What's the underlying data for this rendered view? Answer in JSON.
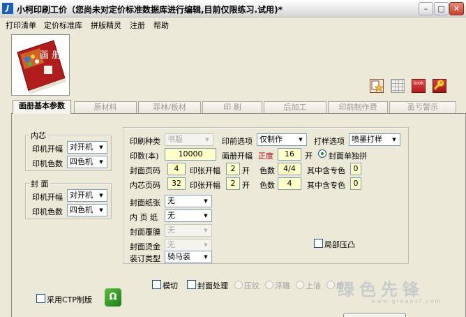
{
  "window": {
    "title": "小柯印刷工价（您尚未对定价标准数据库进行编辑,目前仅限练习.试用)*",
    "app_icon_text": "J",
    "minimize": "–",
    "maximize": "□",
    "close": "✕"
  },
  "menu": [
    "打印清单",
    "定价标准库",
    "拼版精灵",
    "注册",
    "帮助"
  ],
  "product_image": {
    "text": "画 册"
  },
  "toolbar_icons": [
    "star-icon",
    "grid-icon",
    "book-icon",
    "key-icon"
  ],
  "book_icon_text": "book",
  "key_icon_text": "🔑",
  "tabs": [
    "画册基本参数",
    "原材料",
    "菲林/板材",
    "印 刷",
    "后加工",
    "印前制作费",
    "盈亏警示"
  ],
  "inner": {
    "legend": "内芯",
    "size_label": "印机开幅",
    "size_value": "对开机",
    "color_label": "印机色数",
    "color_value": "四色机"
  },
  "cover": {
    "legend": "封 面",
    "size_label": "印机开幅",
    "size_value": "对开机",
    "color_label": "印机色数",
    "color_value": "四色机"
  },
  "form": {
    "print_type_label": "印刷种类",
    "print_type_value": "书版",
    "prepress_label": "印前选项",
    "prepress_value": "仅制作",
    "proof_label": "打样选项",
    "proof_value": "喷墨打样",
    "qty_label": "印数(本)",
    "qty_value": "10000",
    "album_size_label": "画册开幅",
    "album_size_dir": "正度",
    "album_size_value": "16",
    "kai": "开",
    "cover_single_label": "封面单独拼",
    "cover_pages_label": "封面页码",
    "cover_pages_value": "4",
    "sheet_size_label": "印张开幅",
    "cover_sheet_value": "2",
    "colors_label": "色数",
    "cover_colors_value": "4/4",
    "spot_label": "其中含专色",
    "cover_spot_value": "0",
    "inner_pages_label": "内芯页码",
    "inner_pages_value": "32",
    "inner_sheet_value": "2",
    "inner_colors_value": "4",
    "inner_spot_value": "0",
    "cover_paper_label": "封面纸张",
    "cover_paper_value": "无",
    "inner_paper_label": "内 页 纸",
    "inner_paper_value": "无",
    "lamination_label": "封面覆膜",
    "lamination_value": "无",
    "foil_label": "封面烫金",
    "foil_value": "无",
    "binding_label": "装订类型",
    "binding_value": "骑马装",
    "partial_emboss_label": "局部压凸",
    "die_cut_label": "模切",
    "cover_process_label": "封面处理",
    "cover_process_options": [
      "压纹",
      "浮雕",
      "上油",
      "磨光"
    ],
    "ctp_label": "采用CTP制版"
  },
  "ctp_logo_text": "Ω",
  "watermark": {
    "text": "绿色先锋",
    "url": "www.greenxf.com"
  }
}
